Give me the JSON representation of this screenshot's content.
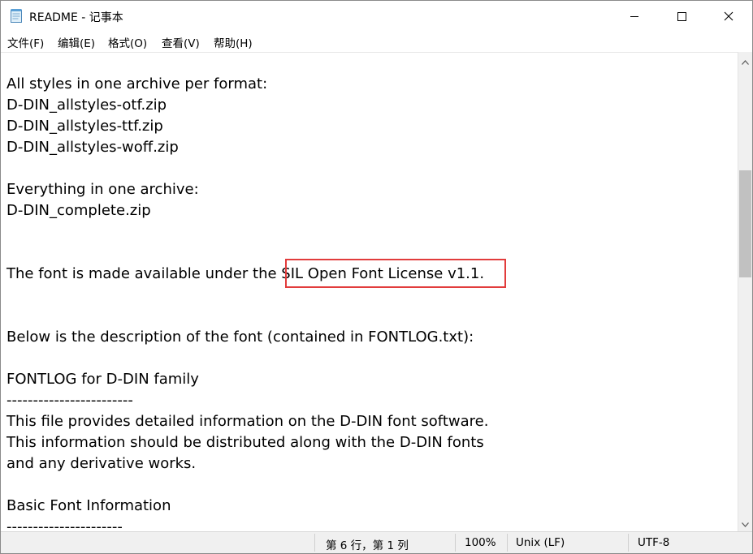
{
  "window": {
    "title": "README - 记事本",
    "icon": "notepad-icon",
    "controls": {
      "minimize": "minimize-icon",
      "maximize": "maximize-icon",
      "close": "close-icon"
    }
  },
  "menu": {
    "items": [
      "文件(F)",
      "编辑(E)",
      "格式(O)",
      "查看(V)",
      "帮助(H)"
    ]
  },
  "editor": {
    "lines": [
      "",
      "All styles in one archive per format:",
      "D-DIN_allstyles-otf.zip",
      "D-DIN_allstyles-ttf.zip",
      "D-DIN_allstyles-woff.zip",
      "",
      "Everything in one archive:",
      "D-DIN_complete.zip",
      "",
      "",
      "The font is made available under the SIL Open Font License v1.1.",
      "",
      "",
      "Below is the description of the font (contained in FONTLOG.txt):",
      "",
      "FONTLOG for D-DIN family",
      "------------------------",
      "This file provides detailed information on the D-DIN font software.",
      "This information should be distributed along with the D-DIN fonts",
      "and any derivative works.",
      "",
      "Basic Font Information",
      "----------------------"
    ],
    "highlight_color": "#e23c3c"
  },
  "scrollbar": {
    "up_icon": "scroll-up-arrow-icon",
    "down_icon": "scroll-down-arrow-icon"
  },
  "status": {
    "position": "第 6 行，第 1 列",
    "zoom": "100%",
    "line_ending": "Unix (LF)",
    "encoding": "UTF-8"
  }
}
